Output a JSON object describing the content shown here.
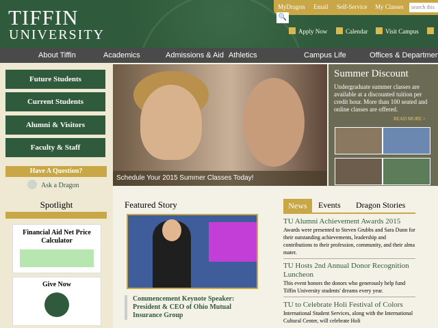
{
  "header": {
    "logo_line1": "TIFFIN",
    "logo_line2": "UNIVERSITY",
    "toplinks": [
      "MyDragon",
      "Email",
      "Self-Service",
      "My Classes"
    ],
    "search_placeholder": "search this",
    "util_links": [
      "Apply Now",
      "Calendar",
      "Visit Campus"
    ]
  },
  "nav": [
    "About Tiffin",
    "Academics",
    "Admissions & Aid",
    "Athletics",
    "Campus Life",
    "Offices & Departments"
  ],
  "sidebar": {
    "buttons": [
      "Future Students",
      "Current Students",
      "Alumni & Visitors",
      "Faculty & Staff"
    ],
    "question": "Have A Question?",
    "ask": "Ask a Dragon",
    "spotlight": "Spotlight",
    "card1": "Financial Aid Net Price Calculator",
    "card2": "Give Now"
  },
  "hero": {
    "banner": "Schedule Your 2015 Summer Classes Today!"
  },
  "discount": {
    "title": "Summer Discount",
    "text": "Undergraduate summer classes are available at a discounted tuition per credit hour. More than 100 seated and online classes are offered.",
    "read_more": "READ MORE >"
  },
  "featured": {
    "heading": "Featured Story",
    "caption": "Commencement Keynote Speaker: President & CEO of Ohio Mutual Insurance Group"
  },
  "news": {
    "tabs": [
      "News",
      "Events",
      "Dragon Stories"
    ],
    "items": [
      {
        "title": "TU Alumni Achievement Awards 2015",
        "body": "Awards were presented to Steven Grubbs and Sara Dunn for their outstanding achievements, leadership and contributions to their profession, community, and their alma mater."
      },
      {
        "title": "TU Hosts 2nd Annual Donor Recognition Luncheon",
        "body": "This event honors the donors who generously help fund Tiffin University students' dreams every year."
      },
      {
        "title": "TU to Celebrate Holi Festival of Colors",
        "body": "International Student Services, along with the International Cultural Center, will celebrate Holi"
      }
    ]
  }
}
